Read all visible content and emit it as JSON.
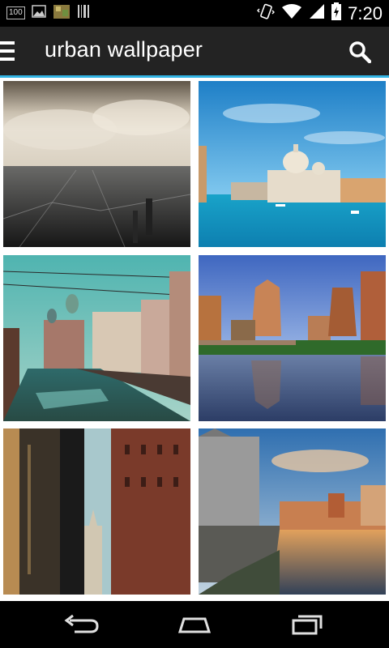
{
  "status_bar": {
    "battery_badge": "100",
    "time": "7:20"
  },
  "action_bar": {
    "title": "urban wallpaper"
  },
  "grid": {
    "tiles": [
      {
        "name": "city-skyline-sepia"
      },
      {
        "name": "venice-grand-canal"
      },
      {
        "name": "st-petersburg-canal"
      },
      {
        "name": "austin-skyline-reflection"
      },
      {
        "name": "tall-buildings-looking-up"
      },
      {
        "name": "canal-houses-sunset"
      }
    ]
  },
  "colors": {
    "accent": "#33b5e5",
    "action_bar_bg": "#232323"
  }
}
